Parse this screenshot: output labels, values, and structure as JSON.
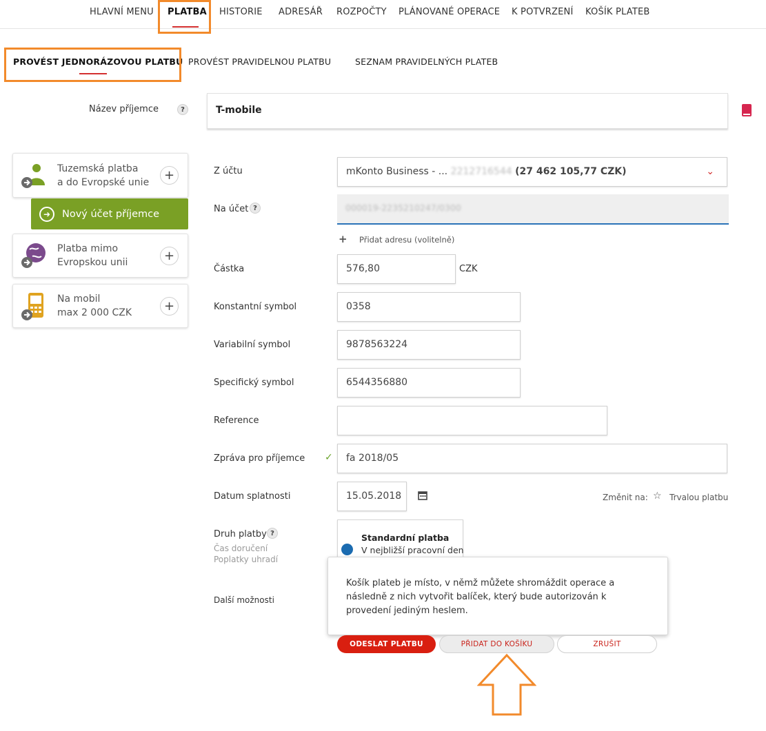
{
  "topnav": {
    "items": [
      "HLAVNÍ MENU",
      "PLATBA",
      "HISTORIE",
      "ADRESÁŘ",
      "ROZPOČTY",
      "PLÁNOVANÉ OPERACE",
      "K POTVRZENÍ",
      "KOŠÍK PLATEB"
    ],
    "active": "PLATBA"
  },
  "subnav": {
    "items": [
      "PROVÉST JEDNORÁZOVOU PLATBU",
      "PROVÉST PRAVIDELNOU PLATBU",
      "SEZNAM PRAVIDELNÝCH PLATEB"
    ],
    "active": "PROVÉST JEDNORÁZOVOU PLATBU"
  },
  "recipient": {
    "label": "Název příjemce",
    "help": "?",
    "value": "T-mobile"
  },
  "sidebar": {
    "cards": [
      {
        "line1": "Tuzemská platba",
        "line2": "a do Evropské unie",
        "icon": "person-arrow-icon"
      },
      {
        "line1": "Platba mimo",
        "line2": "Evropskou unii",
        "icon": "globe-arrow-icon"
      },
      {
        "line1": "Na mobil",
        "line2": "max 2 000 CZK",
        "icon": "mobile-arrow-icon"
      }
    ],
    "new_account": "Nový účet příjemce",
    "plus": "+"
  },
  "form": {
    "from_account": {
      "label": "Z účtu",
      "value_prefix": "mKonto Business - ...",
      "value_masked": "2212716544",
      "balance": "(27 462 105,77 CZK)"
    },
    "to_account": {
      "label": "Na účet",
      "help": "?",
      "value_masked": "000019-2235210247/0300"
    },
    "add_address": {
      "plus": "+",
      "label": "Přidat adresu (volitelně)"
    },
    "amount": {
      "label": "Částka",
      "value": "576,80",
      "currency": "CZK"
    },
    "constant_symbol": {
      "label": "Konstantní symbol",
      "value": "0358"
    },
    "variable_symbol": {
      "label": "Variabilní symbol",
      "value": "9878563224"
    },
    "specific_symbol": {
      "label": "Specifický symbol",
      "value": "6544356880"
    },
    "reference": {
      "label": "Reference",
      "value": ""
    },
    "message": {
      "label": "Zpráva pro příjemce",
      "check": "✓",
      "value": "fa 2018/05"
    },
    "due_date": {
      "label": "Datum splatnosti",
      "value": "15.05.2018",
      "change_to": "Změnit na:",
      "standing_order": "Trvalou platbu"
    },
    "payment_type": {
      "label": "Druh platby",
      "help": "?",
      "sub1": "Čas doručení",
      "sub2": "Poplatky uhradí",
      "card_title": "Standardní platba",
      "card_text": "V nejbližší pracovní den"
    },
    "more_options": {
      "label": "Další možnosti"
    }
  },
  "tooltip": {
    "text": "Košík plateb je místo, v němž můžete shromáždit operace a následně z nich vytvořit balíček, který bude autorizován k provedení jediným heslem."
  },
  "buttons": {
    "send": "ODESLAT PLATBU",
    "add_to_cart": "PŘIDAT DO KOŠÍKU",
    "cancel": "ZRUŠIT"
  },
  "colors": {
    "accent_red": "#d32f2f",
    "highlight_orange": "#f28a2b",
    "green": "#7aa025",
    "blue": "#2a73b8"
  }
}
